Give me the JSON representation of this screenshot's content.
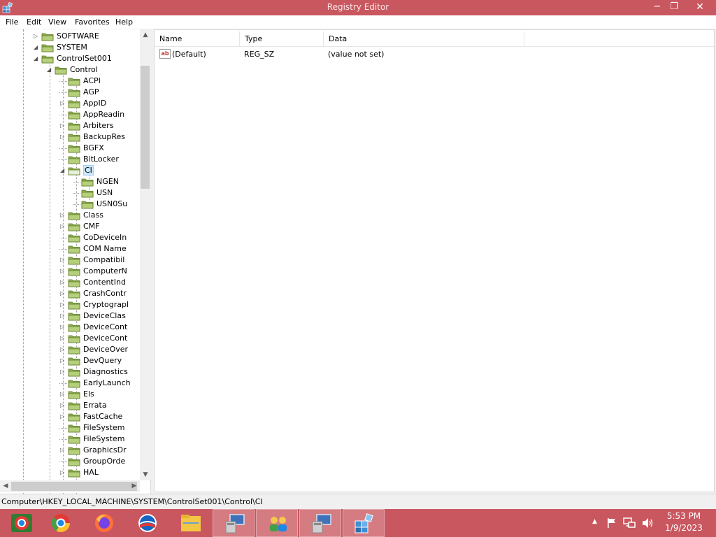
{
  "window": {
    "title": "Registry Editor",
    "minimize": "−",
    "maximize": "❐",
    "close": "✕"
  },
  "menu": [
    "File",
    "Edit",
    "View",
    "Favorites",
    "Help"
  ],
  "tree": {
    "items": [
      {
        "label": "SOFTWARE",
        "toggle": "▷"
      },
      {
        "label": "SYSTEM",
        "toggle": "◢"
      },
      {
        "label": "ControlSet001",
        "toggle": "◢"
      },
      {
        "label": "Control",
        "toggle": "◢"
      },
      {
        "label": "ACPI",
        "toggle": ""
      },
      {
        "label": "AGP",
        "toggle": ""
      },
      {
        "label": "AppID",
        "toggle": "▷"
      },
      {
        "label": "AppReadin",
        "toggle": ""
      },
      {
        "label": "Arbiters",
        "toggle": "▷"
      },
      {
        "label": "BackupRes",
        "toggle": "▷"
      },
      {
        "label": "BGFX",
        "toggle": ""
      },
      {
        "label": "BitLocker",
        "toggle": ""
      },
      {
        "label": "CI",
        "toggle": "◢",
        "selected": true
      },
      {
        "label": "NGEN",
        "toggle": ""
      },
      {
        "label": "USN",
        "toggle": ""
      },
      {
        "label": "USN0Su",
        "toggle": ""
      },
      {
        "label": "Class",
        "toggle": "▷"
      },
      {
        "label": "CMF",
        "toggle": "▷"
      },
      {
        "label": "CoDeviceIn",
        "toggle": ""
      },
      {
        "label": "COM Name",
        "toggle": ""
      },
      {
        "label": "Compatibil",
        "toggle": "▷"
      },
      {
        "label": "ComputerN",
        "toggle": "▷"
      },
      {
        "label": "ContentInd",
        "toggle": "▷"
      },
      {
        "label": "CrashContr",
        "toggle": "▷"
      },
      {
        "label": "Cryptograpl",
        "toggle": "▷"
      },
      {
        "label": "DeviceClas",
        "toggle": "▷"
      },
      {
        "label": "DeviceCont",
        "toggle": "▷"
      },
      {
        "label": "DeviceCont",
        "toggle": "▷"
      },
      {
        "label": "DeviceOver",
        "toggle": "▷"
      },
      {
        "label": "DevQuery",
        "toggle": "▷"
      },
      {
        "label": "Diagnostics",
        "toggle": "▷"
      },
      {
        "label": "EarlyLaunch",
        "toggle": ""
      },
      {
        "label": "Els",
        "toggle": "▷"
      },
      {
        "label": "Errata",
        "toggle": "▷"
      },
      {
        "label": "FastCache",
        "toggle": "▷"
      },
      {
        "label": "FileSystem",
        "toggle": ""
      },
      {
        "label": "FileSystem",
        "toggle": ""
      },
      {
        "label": "GraphicsDr",
        "toggle": "▷"
      },
      {
        "label": "GroupOrde",
        "toggle": ""
      },
      {
        "label": "HAL",
        "toggle": "▷"
      }
    ]
  },
  "scroll": {
    "up": "▲",
    "down": "▼",
    "left": "◀",
    "right": "▶"
  },
  "list": {
    "columns": [
      "Name",
      "Type",
      "Data"
    ],
    "rows": [
      {
        "icon": "ab",
        "name": "(Default)",
        "type": "REG_SZ",
        "data": "(value not set)"
      }
    ]
  },
  "status": {
    "path": "Computer\\HKEY_LOCAL_MACHINE\\SYSTEM\\ControlSet001\\Control\\CI"
  },
  "taskbar": {
    "apps": [
      "chrome-custom-icon",
      "chrome-icon",
      "firefox-icon",
      "obama-logo-icon",
      "file-explorer-icon",
      "remote-desktop-icon",
      "network-users-icon",
      "remote-desktop-icon",
      "registry-editor-icon"
    ],
    "clock_time": "5:53 PM",
    "clock_date": "1/9/2023",
    "tray_show_hidden": "▲"
  },
  "colors": {
    "titlebar": "#c9575f",
    "taskbar": "#c9575f",
    "selection": "#cce8ff",
    "folder": "#8fb04a"
  }
}
